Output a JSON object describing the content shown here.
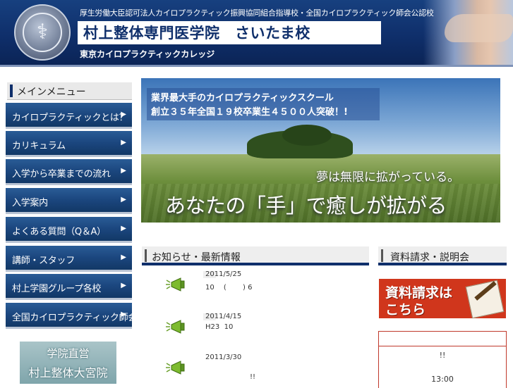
{
  "header": {
    "accreditation": "厚生労働大臣認可法人カイロプラクティック振興協同組合指導校・全国カイロプラクティック師会公認校",
    "school_name": "村上整体専門医学院　さいたま校",
    "college": "東京カイロプラクティックカレッジ",
    "seal_glyph": "⚕"
  },
  "sidebar": {
    "heading": "メインメニュー",
    "arrow": "▶",
    "items": [
      {
        "label": "カイロプラクティックとは？"
      },
      {
        "label": "カリキュラム"
      },
      {
        "label": "入学から卒業までの流れ"
      },
      {
        "label": "入学案内"
      },
      {
        "label": "よくある質問（Q＆A）"
      },
      {
        "label": "講師・スタッフ"
      },
      {
        "label": "村上学園グループ各校"
      },
      {
        "label": "全国カイロプラクティック師会"
      }
    ],
    "banner": {
      "line1": "学院直営",
      "line2": "村上整体大宮院"
    }
  },
  "hero": {
    "caption_line1": "業界最大手のカイロプラクティックスクール",
    "caption_line2": "創立３５年全国１９校卒業生４５００人突破！!",
    "slogan": "夢は無限に拡がっている。",
    "title": "あなたの「手」で癒しが拡がる"
  },
  "news": {
    "heading": "お知らせ・最新情報",
    "items": [
      {
        "date": "2011/5/25",
        "text": "10　 (　　 ) 6"
      },
      {
        "date": "2011/4/15",
        "text": "H23  10"
      },
      {
        "date": "2011/3/30",
        "text": "!!"
      }
    ]
  },
  "request": {
    "heading": "資料請求・説明会",
    "banner_line1": "資料請求は",
    "banner_line2": "こちら",
    "box_excl": "!!",
    "box_time": "13:00"
  },
  "colors": {
    "header_navy": "#0f2f6b",
    "nav_blue": "#1b467e",
    "request_red": "#d0361c"
  }
}
